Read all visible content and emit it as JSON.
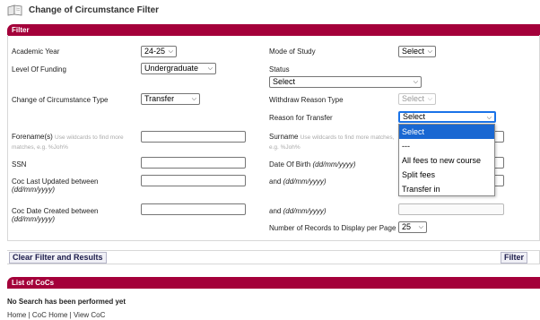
{
  "page": {
    "title": "Change of Circumstance Filter"
  },
  "filter": {
    "header": "Filter",
    "academic_year": {
      "label": "Academic Year",
      "value": "24-25"
    },
    "level_of_funding": {
      "label": "Level Of Funding",
      "value": "Undergraduate"
    },
    "coc_type": {
      "label": "Change of Circumstance Type",
      "value": "Transfer"
    },
    "forename": {
      "label": "Forename(s)",
      "hint": "Use wildcards to find more matches, e.g. %Joh%",
      "value": ""
    },
    "ssn": {
      "label": "SSN",
      "value": ""
    },
    "coc_last_updated": {
      "label": "Coc Last Updated between",
      "format": "(dd/mm/yyyy)",
      "value": ""
    },
    "coc_date_created": {
      "label": "Coc Date Created between",
      "format": "(dd/mm/yyyy)",
      "value": ""
    },
    "mode_of_study": {
      "label": "Mode of Study",
      "value": "Select"
    },
    "status": {
      "label": "Status",
      "value": "Select"
    },
    "withdraw_reason_type": {
      "label": "Withdraw Reason Type",
      "value": "Select"
    },
    "reason_for_transfer": {
      "label": "Reason for Transfer",
      "value": "Select",
      "options": [
        "Select",
        "---",
        "All fees to new course",
        "Split fees",
        "Transfer in"
      ]
    },
    "surname": {
      "label": "Surname",
      "hint": "Use wildcards to find more matches, e.g. %Joh%",
      "value": ""
    },
    "date_of_birth": {
      "label": "Date Of Birth",
      "format": "(dd/mm/yyyy)",
      "value": ""
    },
    "and_label": "and",
    "and_format": "(dd/mm/yyyy)",
    "records_per_page": {
      "label": "Number of Records to Display per Page",
      "value": "25"
    }
  },
  "buttons": {
    "clear": "Clear Filter and Results",
    "filter": "Filter"
  },
  "list": {
    "header": "List of CoCs",
    "message": "No Search has been performed yet"
  },
  "footer": {
    "links": [
      "Home",
      "CoC Home",
      "View CoC"
    ],
    "separator": " | "
  },
  "colors": {
    "accent": "#a4003a",
    "select_highlight": "#1967d2"
  },
  "icons": {
    "page_icon": "book-icon",
    "chevron": "chevron-down-icon"
  }
}
